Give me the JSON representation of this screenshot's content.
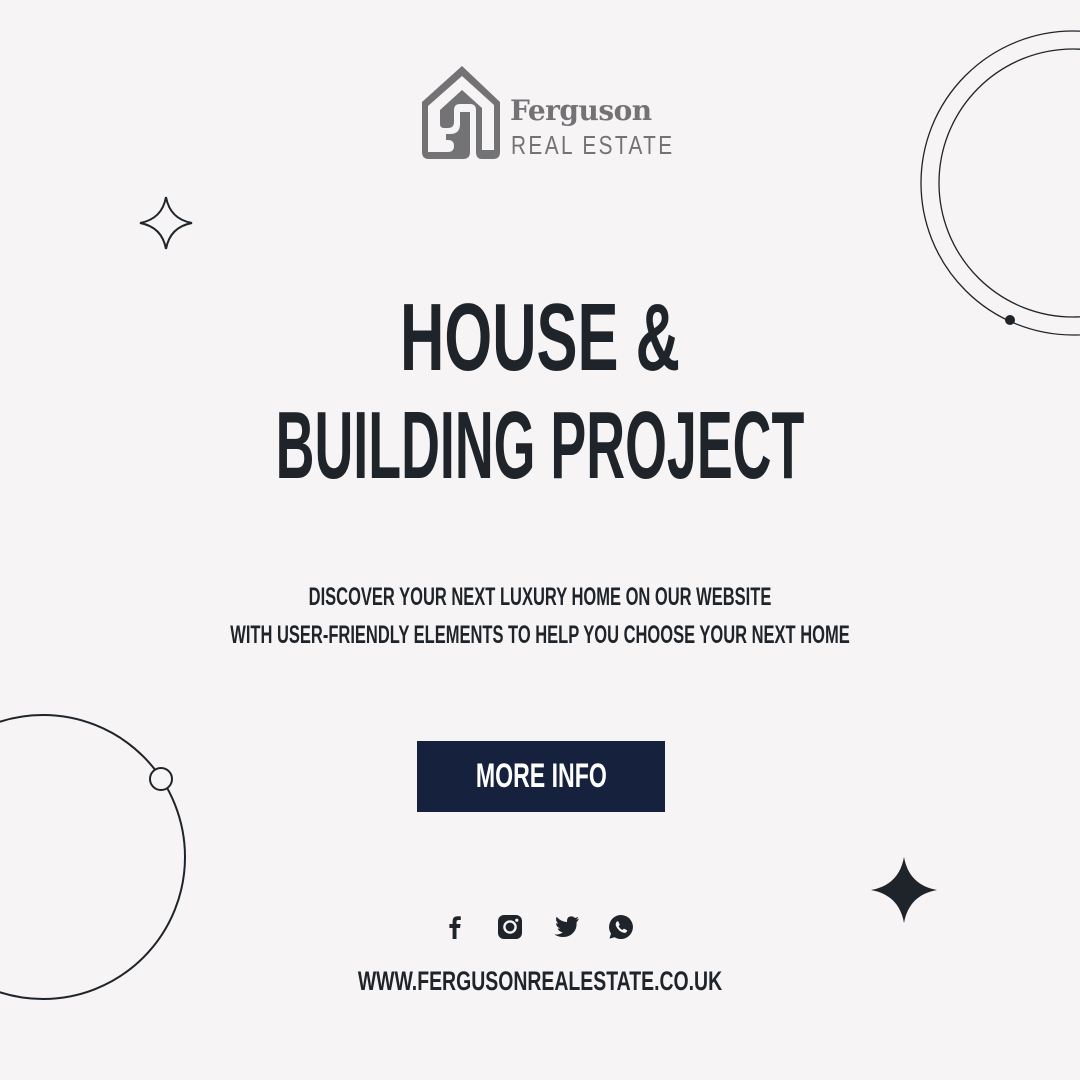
{
  "brand": {
    "name": "Ferguson",
    "tagline": "REAL ESTATE"
  },
  "headline": {
    "line1": "HOUSE &",
    "line2": "BUILDING PROJECT"
  },
  "subtext": {
    "line1": "DISCOVER YOUR NEXT LUXURY HOME ON OUR WEBSITE",
    "line2": "WITH USER-FRIENDLY ELEMENTS TO HELP YOU CHOOSE YOUR NEXT HOME"
  },
  "cta": {
    "label": "MORE INFO"
  },
  "socials": [
    {
      "icon": "facebook-icon"
    },
    {
      "icon": "instagram-icon"
    },
    {
      "icon": "twitter-icon"
    },
    {
      "icon": "whatsapp-icon"
    }
  ],
  "website": "WWW.FERGUSONREALESTATE.CO.UK",
  "colors": {
    "background": "#f6f4f5",
    "text": "#1e2429",
    "button": "#15213d",
    "logo": "#737274"
  }
}
